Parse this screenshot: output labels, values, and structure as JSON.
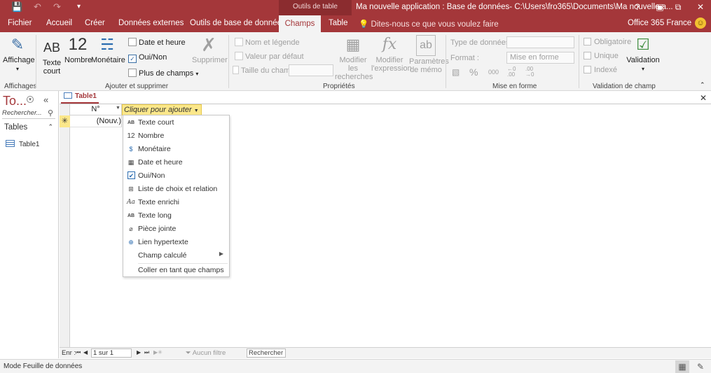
{
  "titlebar": {
    "contextual_group": "Outils de table",
    "app_title": "Ma nouvelle application : Base de données- C:\\Users\\fro365\\Documents\\Ma nouvelle a...",
    "help": "?",
    "restore": "⧉",
    "close": "✕"
  },
  "tabs": [
    {
      "label": "Fichier"
    },
    {
      "label": "Accueil"
    },
    {
      "label": "Créer"
    },
    {
      "label": "Données externes"
    },
    {
      "label": "Outils de base de données"
    },
    {
      "label": "Champs"
    },
    {
      "label": "Table"
    }
  ],
  "tellme": "Dites-nous ce que vous voulez faire",
  "account": "Office 365 France",
  "ribbon": {
    "affichage": {
      "label": "Affichage",
      "group": "Affichages"
    },
    "ajouter": {
      "group": "Ajouter et supprimer",
      "texte_court": "Texte court",
      "texte_court_icon": "AB",
      "nombre": "Nombre",
      "nombre_icon": "12",
      "monetaire": "Monétaire",
      "date_heure": "Date et heure",
      "oui_non": "Oui/Non",
      "plus_champs": "Plus de champs",
      "supprimer": "Supprimer"
    },
    "proprietes": {
      "group": "Propriétés",
      "nom_legende": "Nom et légende",
      "valeur_defaut": "Valeur par défaut",
      "taille_champ": "Taille du champ",
      "modifier_recherches": "Modifier les recherches",
      "modifier_expression": "Modifier l'expression",
      "parametres_memo": "Paramètres de mémo"
    },
    "mise_en_forme": {
      "group": "Mise en forme",
      "type_donnees": "Type de données :",
      "format": "Format :",
      "format_value": "Mise en forme"
    },
    "validation": {
      "group": "Validation de champ",
      "obligatoire": "Obligatoire",
      "unique": "Unique",
      "indexe": "Indexé",
      "validation": "Validation"
    }
  },
  "nav": {
    "title": "To...",
    "search_placeholder": "Rechercher...",
    "section": "Tables",
    "items": [
      {
        "label": "Table1"
      }
    ]
  },
  "document": {
    "tab_label": "Table1",
    "columns": [
      {
        "label": "N°"
      },
      {
        "label": "Cliquer pour ajouter"
      }
    ],
    "new_row_value": "(Nouv.)"
  },
  "menu": {
    "items": [
      {
        "label": "Texte court",
        "icon": "AB"
      },
      {
        "label": "Nombre",
        "icon": "12"
      },
      {
        "label": "Monétaire",
        "icon": "$"
      },
      {
        "label": "Date et heure",
        "icon": "▦"
      },
      {
        "label": "Oui/Non",
        "icon": "✔"
      },
      {
        "label": "Liste de choix et relation",
        "icon": "⊞"
      },
      {
        "label": "Texte enrichi",
        "icon": "Aa"
      },
      {
        "label": "Texte long",
        "icon": "AB"
      },
      {
        "label": "Pièce jointe",
        "icon": "⌀"
      },
      {
        "label": "Lien hypertexte",
        "icon": "⊕"
      },
      {
        "label": "Champ calculé",
        "icon": ""
      },
      {
        "label": "Coller en tant que champs",
        "icon": ""
      }
    ]
  },
  "recbar": {
    "label": "Enr :",
    "current": "1 sur 1",
    "filter": "Aucun filtre",
    "search": "Rechercher"
  },
  "status": {
    "text": "Mode Feuille de données"
  },
  "colors": {
    "accent": "#a4373a",
    "highlight": "#fbe78a"
  }
}
